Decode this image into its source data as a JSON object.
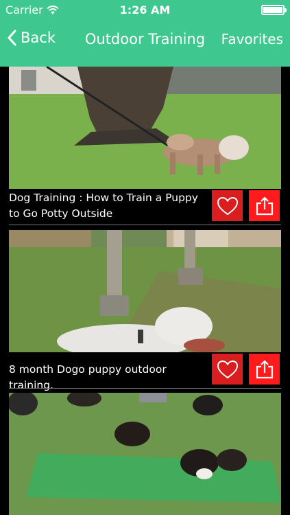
{
  "status_bar": {
    "carrier": "Carrier",
    "time": "1:26 AM"
  },
  "nav": {
    "back_label": "Back",
    "title": "Outdoor Training",
    "favorites_label": "Favorites"
  },
  "videos": [
    {
      "title": "Dog Training : How to Train a Puppy to Go Potty Outside"
    },
    {
      "title": "8 month Dogo puppy outdoor training."
    },
    {
      "title": ""
    }
  ],
  "colors": {
    "accent": "#3ec88f",
    "favorite_button": "#d81e1e",
    "share_button": "#ff1b1b"
  },
  "icons": {
    "favorite": "heart-icon",
    "share": "share-icon",
    "back": "chevron-left-icon",
    "wifi": "wifi-icon",
    "battery": "battery-icon"
  }
}
